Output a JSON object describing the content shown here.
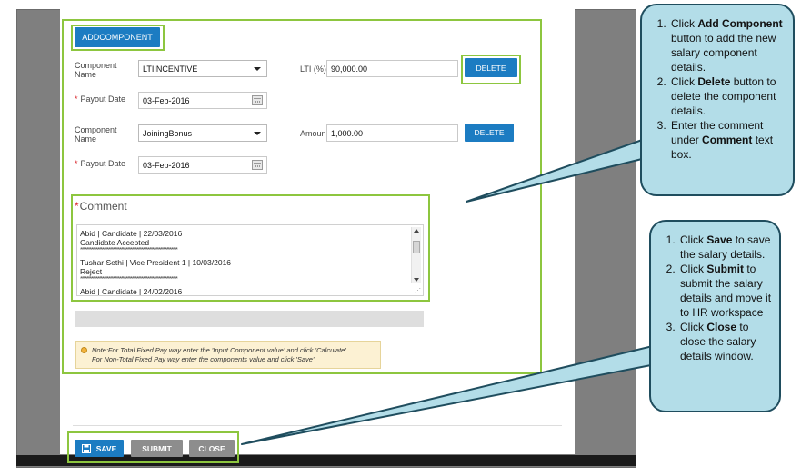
{
  "toolbar": {
    "add_component_label": "ADDCOMPONENT"
  },
  "components": [
    {
      "name_label": "Component Name",
      "name_value": "LTIINCENTIVE",
      "amount_label": "LTI (%)",
      "amount_value": "90,000.00",
      "delete_label": "DELETE",
      "payout_label": "Payout Date",
      "payout_value": "03-Feb-2016"
    },
    {
      "name_label": "Component Name",
      "name_value": "JoiningBonus",
      "amount_label": "Amoun",
      "amount_value": "1,000.00",
      "delete_label": "DELETE",
      "payout_label": "Payout Date",
      "payout_value": "03-Feb-2016"
    }
  ],
  "required_marker": "*",
  "comment": {
    "label": "Comment",
    "entries": [
      {
        "header": "Abid  | Candidate | 22/03/2016",
        "body": "Candidate Accepted"
      },
      {
        "header": "Tushar Sethi | Vice President 1 | 10/03/2016",
        "body": "Reject"
      },
      {
        "header": "Abid  | Candidate | 24/02/2016",
        "body": ""
      }
    ],
    "separator": "**************************************************************"
  },
  "note": {
    "line1": "Note:For Total Fixed Pay way enter the 'Input Component value' and click 'Calculate'",
    "line2": "For Non-Total Fixed Pay way enter the components value and click 'Save'"
  },
  "footer": {
    "save_label": "SAVE",
    "submit_label": "SUBMIT",
    "close_label": "CLOSE"
  },
  "callout_top": {
    "items": [
      {
        "pre": "Click ",
        "bold": "Add Component",
        "post": " button to add the new salary component details."
      },
      {
        "pre": "Click ",
        "bold": "Delete",
        "post": " button to delete the component details."
      },
      {
        "pre": "Enter the comment under ",
        "bold": "Comment",
        "post": " text box."
      }
    ]
  },
  "callout_bottom": {
    "items": [
      {
        "pre": "Click ",
        "bold": "Save",
        "post": " to save the salary details."
      },
      {
        "pre": "Click ",
        "bold": "Submit",
        "post": " to submit the salary details and move it to HR workspace"
      },
      {
        "pre": "Click ",
        "bold": "Close",
        "post": " to close the salary details window."
      }
    ]
  },
  "colors": {
    "primary_button": "#1c7cc2",
    "secondary_button": "#8d8d8d",
    "highlight": "#8dc63f",
    "callout_fill": "#b3dde8",
    "callout_border": "#1f4d5e"
  }
}
